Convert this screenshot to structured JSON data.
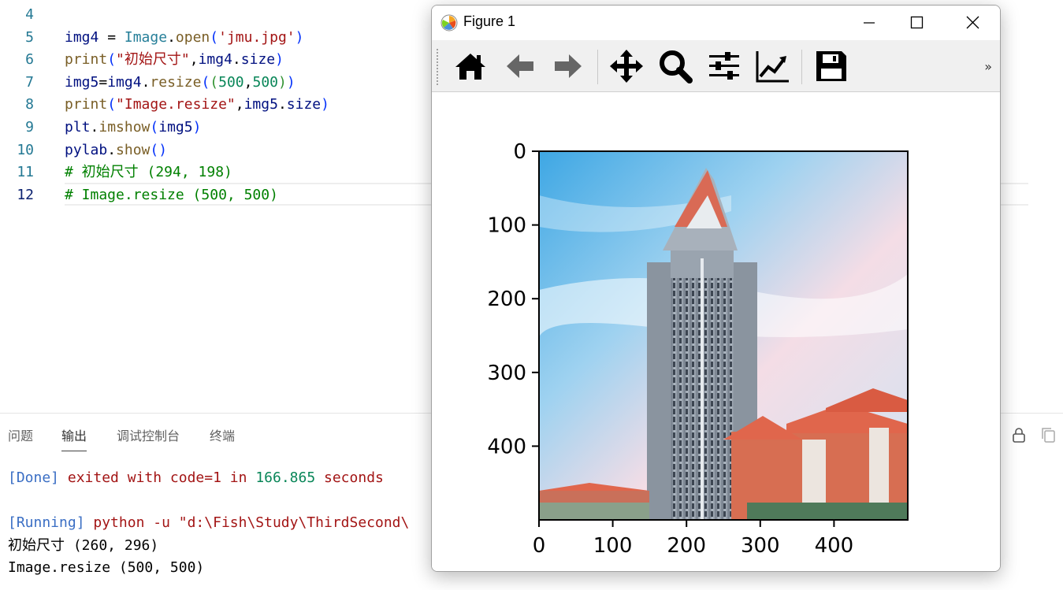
{
  "editor": {
    "lines": [
      {
        "num": "4",
        "tokens": []
      },
      {
        "num": "5",
        "tokens": [
          [
            "img4",
            "t-var"
          ],
          [
            " = ",
            "t-op"
          ],
          [
            "Image",
            "t-cls"
          ],
          [
            ".",
            "t-op"
          ],
          [
            "open",
            "t-fn"
          ],
          [
            "(",
            "t-b1"
          ],
          [
            "'jmu.jpg'",
            "t-str"
          ],
          [
            ")",
            "t-b1"
          ]
        ]
      },
      {
        "num": "6",
        "tokens": [
          [
            "print",
            "t-fn"
          ],
          [
            "(",
            "t-b1"
          ],
          [
            "\"初始尺寸\"",
            "t-str"
          ],
          [
            ",",
            "t-op"
          ],
          [
            "img4",
            "t-var"
          ],
          [
            ".",
            "t-op"
          ],
          [
            "size",
            "t-var"
          ],
          [
            ")",
            "t-b1"
          ]
        ]
      },
      {
        "num": "7",
        "tokens": [
          [
            "img5",
            "t-var"
          ],
          [
            "=",
            "t-op"
          ],
          [
            "img4",
            "t-var"
          ],
          [
            ".",
            "t-op"
          ],
          [
            "resize",
            "t-fn"
          ],
          [
            "(",
            "t-b1"
          ],
          [
            "(",
            "t-b2"
          ],
          [
            "500",
            "t-num"
          ],
          [
            ",",
            "t-op"
          ],
          [
            "500",
            "t-num"
          ],
          [
            ")",
            "t-b2"
          ],
          [
            ")",
            "t-b1"
          ]
        ]
      },
      {
        "num": "8",
        "tokens": [
          [
            "print",
            "t-fn"
          ],
          [
            "(",
            "t-b1"
          ],
          [
            "\"Image.resize\"",
            "t-str"
          ],
          [
            ",",
            "t-op"
          ],
          [
            "img5",
            "t-var"
          ],
          [
            ".",
            "t-op"
          ],
          [
            "size",
            "t-var"
          ],
          [
            ")",
            "t-b1"
          ]
        ]
      },
      {
        "num": "9",
        "tokens": [
          [
            "plt",
            "t-var"
          ],
          [
            ".",
            "t-op"
          ],
          [
            "imshow",
            "t-fn"
          ],
          [
            "(",
            "t-b1"
          ],
          [
            "img5",
            "t-var"
          ],
          [
            ")",
            "t-b1"
          ]
        ]
      },
      {
        "num": "10",
        "tokens": [
          [
            "pylab",
            "t-var"
          ],
          [
            ".",
            "t-op"
          ],
          [
            "show",
            "t-fn"
          ],
          [
            "()",
            "t-b1"
          ]
        ]
      },
      {
        "num": "11",
        "tokens": [
          [
            "# 初始尺寸 (294, 198)",
            "t-cmt"
          ]
        ]
      },
      {
        "num": "12",
        "tokens": [
          [
            "# Image.resize (500, 500)",
            "t-cmt"
          ]
        ],
        "active": true
      }
    ]
  },
  "panel": {
    "tabs": [
      {
        "label": "问题",
        "active": false
      },
      {
        "label": "输出",
        "active": true
      },
      {
        "label": "调试控制台",
        "active": false
      },
      {
        "label": "终端",
        "active": false
      }
    ],
    "output": [
      [
        [
          "[Done]",
          "o-blue"
        ],
        [
          " exited with ",
          "o-red"
        ],
        [
          "code=1",
          "o-red"
        ],
        [
          " in ",
          "o-red"
        ],
        [
          "166.865",
          "o-green"
        ],
        [
          " seconds",
          "o-red"
        ]
      ],
      [],
      [
        [
          "[Running]",
          "o-blue"
        ],
        [
          " python -u \"d:\\Fish\\Study\\ThirdSecond\\",
          "o-red"
        ]
      ],
      [
        [
          "初始尺寸 (260, 296)",
          "o-black"
        ]
      ],
      [
        [
          "Image.resize (500, 500)",
          "o-black"
        ]
      ]
    ]
  },
  "figure": {
    "title": "Figure 1",
    "toolbar": {
      "more": "»"
    },
    "colors": {
      "sky": "#9fcfee",
      "building": "#8f9aa6",
      "roof": "#e0664c"
    }
  },
  "chart_data": {
    "type": "image",
    "xticks": [
      "0",
      "100",
      "200",
      "300",
      "400"
    ],
    "yticks": [
      "0",
      "100",
      "200",
      "300",
      "400"
    ],
    "xlim": [
      0,
      500
    ],
    "ylim": [
      500,
      0
    ]
  }
}
